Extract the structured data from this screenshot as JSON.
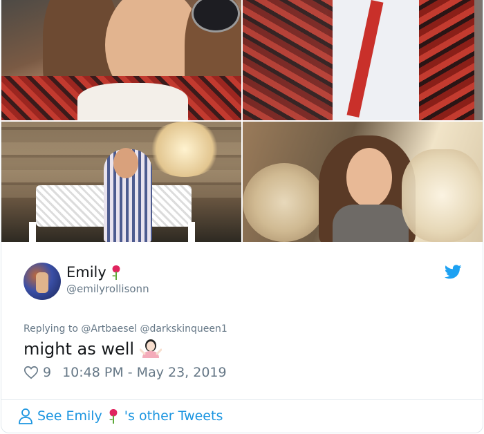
{
  "tweet": {
    "author": {
      "name": "Emily",
      "handle": "@emilyrollisonn"
    },
    "replying_to": "Replying to @Artbaesel @darkskinqueen1",
    "text": "might as well",
    "likes": "9",
    "timestamp": "10:48 PM - May 23, 2019",
    "see_more_prefix": "See Emily",
    "see_more_suffix": "'s other Tweets"
  },
  "icons": {
    "brand": "twitter-bird-icon",
    "like": "heart-icon",
    "profile": "person-icon",
    "emoji_rose": "rose-icon",
    "emoji_shrug": "woman-shrugging-icon"
  },
  "colors": {
    "link": "#1b95e0",
    "muted": "#657786",
    "text": "#14171a",
    "border": "#e1e8ed"
  }
}
